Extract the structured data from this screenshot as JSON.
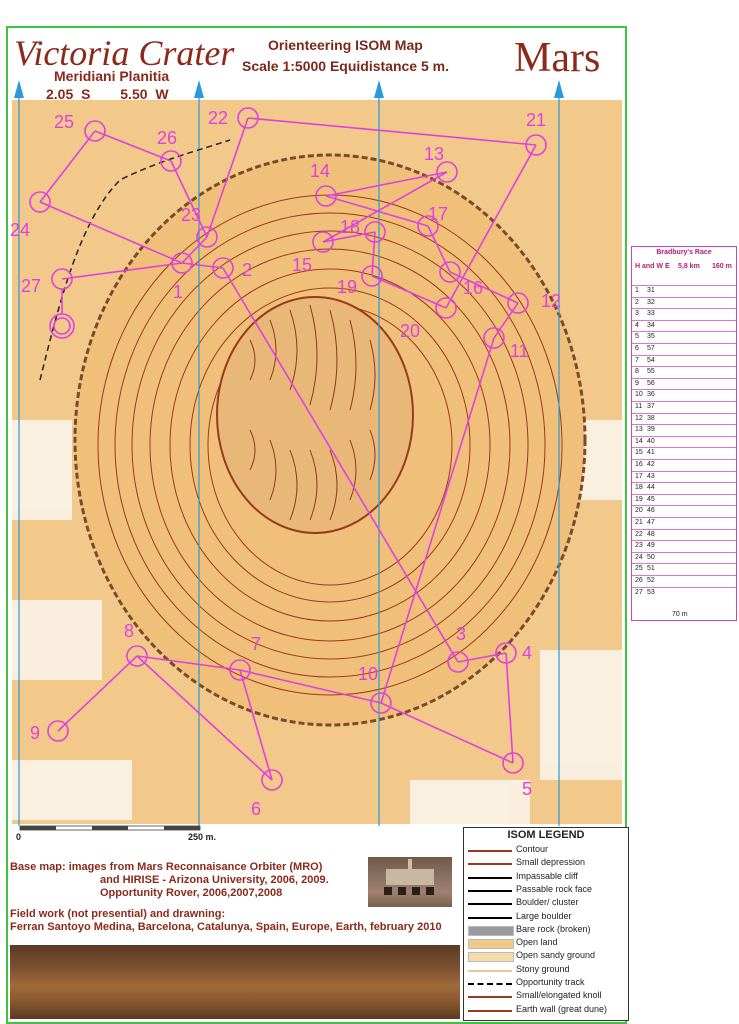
{
  "header": {
    "title": "Victoria Crater",
    "region": "Meridiani Planitia",
    "lat": "2.05 S",
    "lon": "5.50 W",
    "map_title": "Orienteering ISOM Map",
    "scale": "Scale 1:5000  Equidistance 5 m.",
    "planet": "Mars"
  },
  "scale_bar": {
    "start": "0",
    "end": "250 m."
  },
  "credits": {
    "line1": "Base map: images from Mars Reconnaisance Orbiter (MRO)",
    "line2": "and HIRISE - Arizona University, 2006, 2009.",
    "line3": "Opportunity Rover, 2006,2007,2008",
    "field1": "Field work (not presential) and drawning:",
    "field2": "Ferran Santoyo Medina, Barcelona, Catalunya, Spain, Europe, Earth, february 2010"
  },
  "legend": {
    "title": "ISOM LEGEND",
    "items": [
      "Contour",
      "Small depression",
      "Impassable cliff",
      "Passable rock face",
      "Boulder/ cluster",
      "Large boulder",
      "Bare rock (broken)",
      "Open land",
      "Open sandy ground",
      "Stony ground",
      "Opportunity track",
      "Small/elongated knoll",
      "Earth wall (great dune)"
    ]
  },
  "race": {
    "title": "Bradbury's Race",
    "hdr_code": "H and W  E",
    "hdr_len": "5,8 km",
    "hdr_climb": "160 m",
    "footer": "70 m",
    "rows": [
      [
        "1",
        "31"
      ],
      [
        "2",
        "32"
      ],
      [
        "3",
        "33"
      ],
      [
        "4",
        "34"
      ],
      [
        "5",
        "35"
      ],
      [
        "6",
        "57"
      ],
      [
        "7",
        "54"
      ],
      [
        "8",
        "55"
      ],
      [
        "9",
        "56"
      ],
      [
        "10",
        "36"
      ],
      [
        "11",
        "37"
      ],
      [
        "12",
        "38"
      ],
      [
        "13",
        "39"
      ],
      [
        "14",
        "40"
      ],
      [
        "15",
        "41"
      ],
      [
        "16",
        "42"
      ],
      [
        "17",
        "43"
      ],
      [
        "18",
        "44"
      ],
      [
        "19",
        "45"
      ],
      [
        "20",
        "46"
      ],
      [
        "21",
        "47"
      ],
      [
        "22",
        "48"
      ],
      [
        "23",
        "49"
      ],
      [
        "24",
        "50"
      ],
      [
        "25",
        "51"
      ],
      [
        "26",
        "52"
      ],
      [
        "27",
        "53"
      ]
    ]
  },
  "controls": [
    {
      "n": "1"
    },
    {
      "n": "2"
    },
    {
      "n": "3"
    },
    {
      "n": "4"
    },
    {
      "n": "5"
    },
    {
      "n": "6"
    },
    {
      "n": "7"
    },
    {
      "n": "8"
    },
    {
      "n": "9"
    },
    {
      "n": "10"
    },
    {
      "n": "11"
    },
    {
      "n": "12"
    },
    {
      "n": "13"
    },
    {
      "n": "14"
    },
    {
      "n": "15"
    },
    {
      "n": "16"
    },
    {
      "n": "17"
    },
    {
      "n": "18"
    },
    {
      "n": "19"
    },
    {
      "n": "20"
    },
    {
      "n": "21"
    },
    {
      "n": "22"
    },
    {
      "n": "23"
    },
    {
      "n": "24"
    },
    {
      "n": "25"
    },
    {
      "n": "26"
    },
    {
      "n": "27"
    }
  ],
  "colors": {
    "map_ground": "#f2c98a",
    "contour": "#9a3a1c",
    "course": "#e040e0",
    "north_lines": "#2a9ad8",
    "frame": "#3ec43e"
  }
}
